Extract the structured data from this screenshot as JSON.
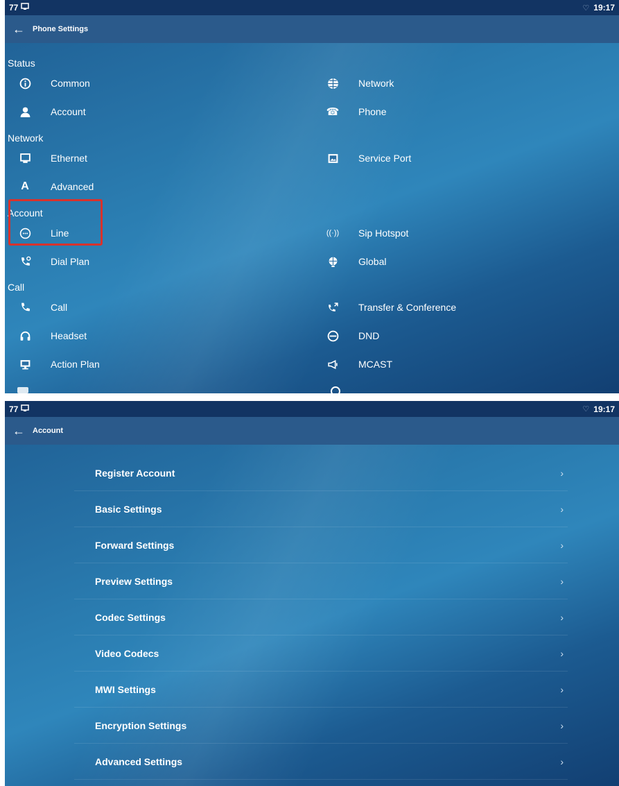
{
  "screen1": {
    "status": {
      "left_text": "77",
      "time": "19:17"
    },
    "title": "Phone Settings",
    "sections": {
      "status": "Status",
      "network": "Network",
      "account": "Account",
      "call": "Call"
    },
    "items": {
      "common": "Common",
      "network": "Network",
      "account": "Account",
      "phone": "Phone",
      "ethernet": "Ethernet",
      "service_port": "Service Port",
      "advanced": "Advanced",
      "line": "Line",
      "sip_hotspot": "Sip Hotspot",
      "dial_plan": "Dial Plan",
      "global": "Global",
      "call": "Call",
      "transfer_conference": "Transfer & Conference",
      "headset": "Headset",
      "dnd": "DND",
      "action_plan": "Action Plan",
      "mcast": "MCAST"
    }
  },
  "screen2": {
    "status": {
      "left_text": "77",
      "time": "19:17"
    },
    "title": "Account",
    "rows": [
      {
        "label": "Register Account"
      },
      {
        "label": "Basic Settings"
      },
      {
        "label": "Forward Settings"
      },
      {
        "label": "Preview Settings"
      },
      {
        "label": "Codec Settings"
      },
      {
        "label": "Video Codecs"
      },
      {
        "label": "MWI Settings"
      },
      {
        "label": "Encryption Settings"
      },
      {
        "label": "Advanced Settings"
      }
    ],
    "chevron": "›"
  },
  "colors": {
    "highlight": "#d8322c",
    "statusbar": "#123463",
    "titlebar": "#2b5a8b"
  }
}
